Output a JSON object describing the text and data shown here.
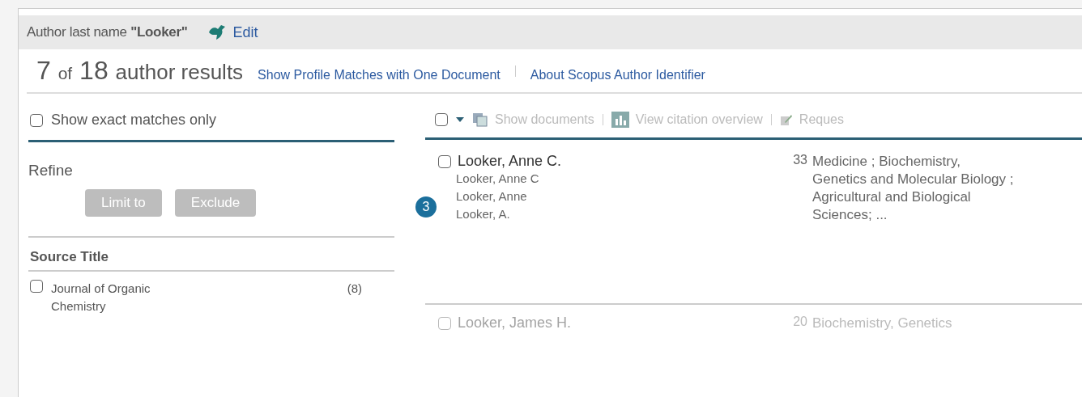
{
  "search_bar": {
    "query_label": "Author last name ",
    "query_value": "\"Looker\"",
    "edit_link": "Edit"
  },
  "results_heading": {
    "shown": "7",
    "of": "of",
    "total": "18",
    "label": "author results",
    "links": [
      "Show Profile Matches with One Document",
      "About Scopus Author Identifier"
    ]
  },
  "exact_matches": {
    "label": "Show exact matches only",
    "checked": false
  },
  "refine": {
    "title": "Refine",
    "buttons": [
      {
        "label": "Limit to",
        "disabled": true
      },
      {
        "label": "Exclude",
        "disabled": true
      }
    ],
    "facets": [
      {
        "title": "Source Title",
        "items": [
          {
            "label": "Journal of Organic Chemistry",
            "count": "(8)",
            "checked": false
          }
        ]
      }
    ]
  },
  "toolbar": {
    "select_all_checked": false,
    "actions": [
      {
        "kind": "documents",
        "label": "Show documents",
        "disabled": true
      },
      {
        "kind": "chart",
        "label": "View citation overview",
        "disabled": true
      },
      {
        "kind": "edit",
        "label": "Reques",
        "disabled": true
      }
    ]
  },
  "callout": "3",
  "authors": [
    {
      "name": "Looker, Anne C.",
      "variants": [
        "Looker, Anne C",
        "Looker, Anne",
        "Looker, A."
      ],
      "documents": "33",
      "subjects": "Medicine ; Biochemistry, Genetics and Molecular Biology ; Agricultural and Biological Sciences; ...",
      "checked": false
    },
    {
      "name": "Looker, James H.",
      "documents": "20",
      "subjects": "Biochemistry, Genetics",
      "checked": false
    }
  ]
}
